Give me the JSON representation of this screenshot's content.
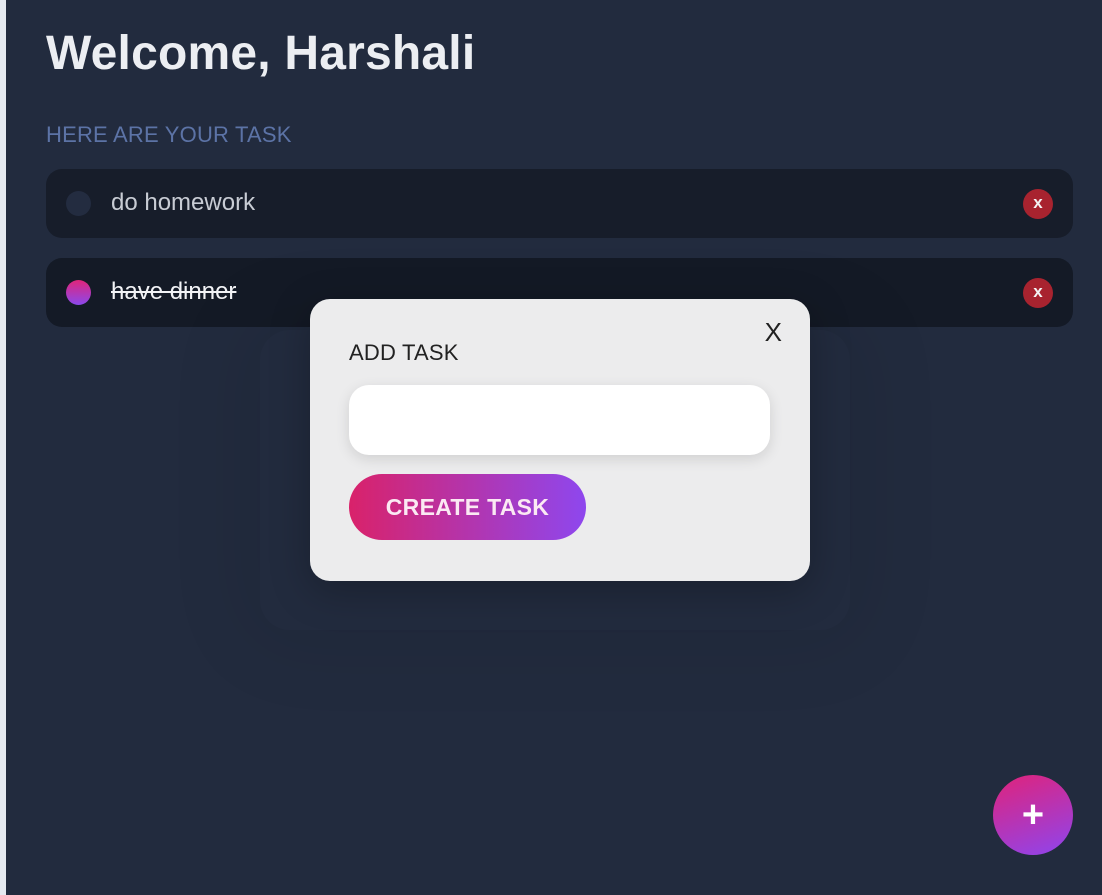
{
  "header": {
    "greeting": "Welcome, Harshali",
    "subtitle": "HERE ARE YOUR TASK"
  },
  "tasks": [
    {
      "label": "do homework",
      "completed": false,
      "delete_label": "x"
    },
    {
      "label": "have dinner",
      "completed": true,
      "delete_label": "x"
    }
  ],
  "modal": {
    "title": "ADD TASK",
    "close_label": "X",
    "input_value": "",
    "input_placeholder": "",
    "create_label": "CREATE TASK"
  },
  "fab": {
    "label": "+",
    "icon": "plus-icon"
  },
  "colors": {
    "background": "#222b3e",
    "task_bg": "#171d2a",
    "accent_start": "#d9226a",
    "accent_end": "#8e47ee",
    "delete": "#a8232f",
    "subtitle": "#5c73a6"
  }
}
